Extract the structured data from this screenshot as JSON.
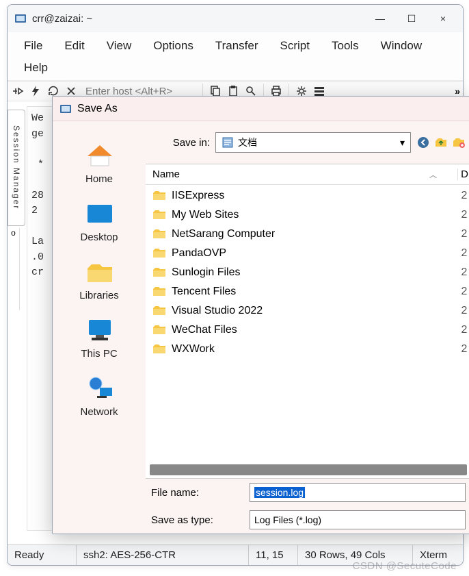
{
  "window": {
    "title": "crr@zaizai: ~",
    "minimize": "—",
    "maximize": "☐",
    "close": "×"
  },
  "menu": [
    "File",
    "Edit",
    "View",
    "Options",
    "Transfer",
    "Script",
    "Tools",
    "Window",
    "Help"
  ],
  "toolbar": {
    "host_placeholder": "Enter host <Alt+R>",
    "overflow": "»"
  },
  "session_manager_tab": "Session Manager",
  "side_strip": "o",
  "terminal_lines": "We\nge\n\n *\n\n28\n2\n\nLa\n.0\ncr",
  "statusbar": {
    "ready": "Ready",
    "conn": "ssh2: AES-256-CTR",
    "cursor": "11, 15",
    "size": "30 Rows, 49 Cols",
    "term": "Xterm"
  },
  "dialog": {
    "title": "Save As",
    "save_in_label": "Save in:",
    "save_in_value": "文档",
    "places": [
      {
        "key": "home",
        "label": "Home"
      },
      {
        "key": "desktop",
        "label": "Desktop"
      },
      {
        "key": "libraries",
        "label": "Libraries"
      },
      {
        "key": "thispc",
        "label": "This PC"
      },
      {
        "key": "network",
        "label": "Network"
      }
    ],
    "list_header_name": "Name",
    "list_header_d": "D",
    "folders": [
      {
        "name": "IISExpress",
        "d": "2"
      },
      {
        "name": "My Web Sites",
        "d": "2"
      },
      {
        "name": "NetSarang Computer",
        "d": "2"
      },
      {
        "name": "PandaOVP",
        "d": "2"
      },
      {
        "name": "Sunlogin Files",
        "d": "2"
      },
      {
        "name": "Tencent Files",
        "d": "2"
      },
      {
        "name": "Visual Studio 2022",
        "d": "2"
      },
      {
        "name": "WeChat Files",
        "d": "2"
      },
      {
        "name": "WXWork",
        "d": "2"
      }
    ],
    "file_name_label": "File name:",
    "file_name_value": "session.log",
    "save_type_label": "Save as type:",
    "save_type_value": "Log Files (*.log)"
  },
  "watermark": "CSDN @SecuteCode"
}
